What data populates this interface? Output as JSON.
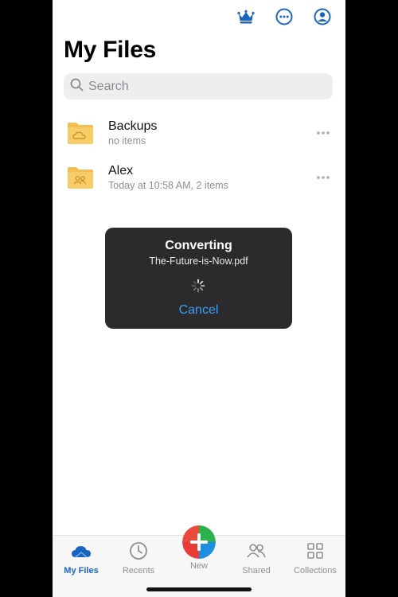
{
  "header": {
    "title": "My Files",
    "icons": [
      "crown-icon",
      "more-circle-icon",
      "account-icon"
    ]
  },
  "search": {
    "placeholder": "Search"
  },
  "files": [
    {
      "name": "Backups",
      "meta": "no items",
      "icon": "cloud-folder-icon"
    },
    {
      "name": "Alex",
      "meta": "Today at 10:58 AM, 2 items",
      "icon": "shared-folder-icon"
    }
  ],
  "dialog": {
    "title": "Converting",
    "filename": "The-Future-is-Now.pdf",
    "cancel_label": "Cancel"
  },
  "tabbar": {
    "tabs": [
      {
        "label": "My Files",
        "icon": "cloud-icon",
        "active": true
      },
      {
        "label": "Recents",
        "icon": "clock-icon",
        "active": false
      },
      {
        "label": "New",
        "icon": "plus-icon",
        "active": false
      },
      {
        "label": "Shared",
        "icon": "people-icon",
        "active": false
      },
      {
        "label": "Collections",
        "icon": "grid-icon",
        "active": false
      }
    ]
  },
  "colors": {
    "accent": "#1a65c0",
    "dialog_bg": "#2b2b2d",
    "cancel": "#3aa0f2",
    "folder": "#f7cd6a"
  }
}
